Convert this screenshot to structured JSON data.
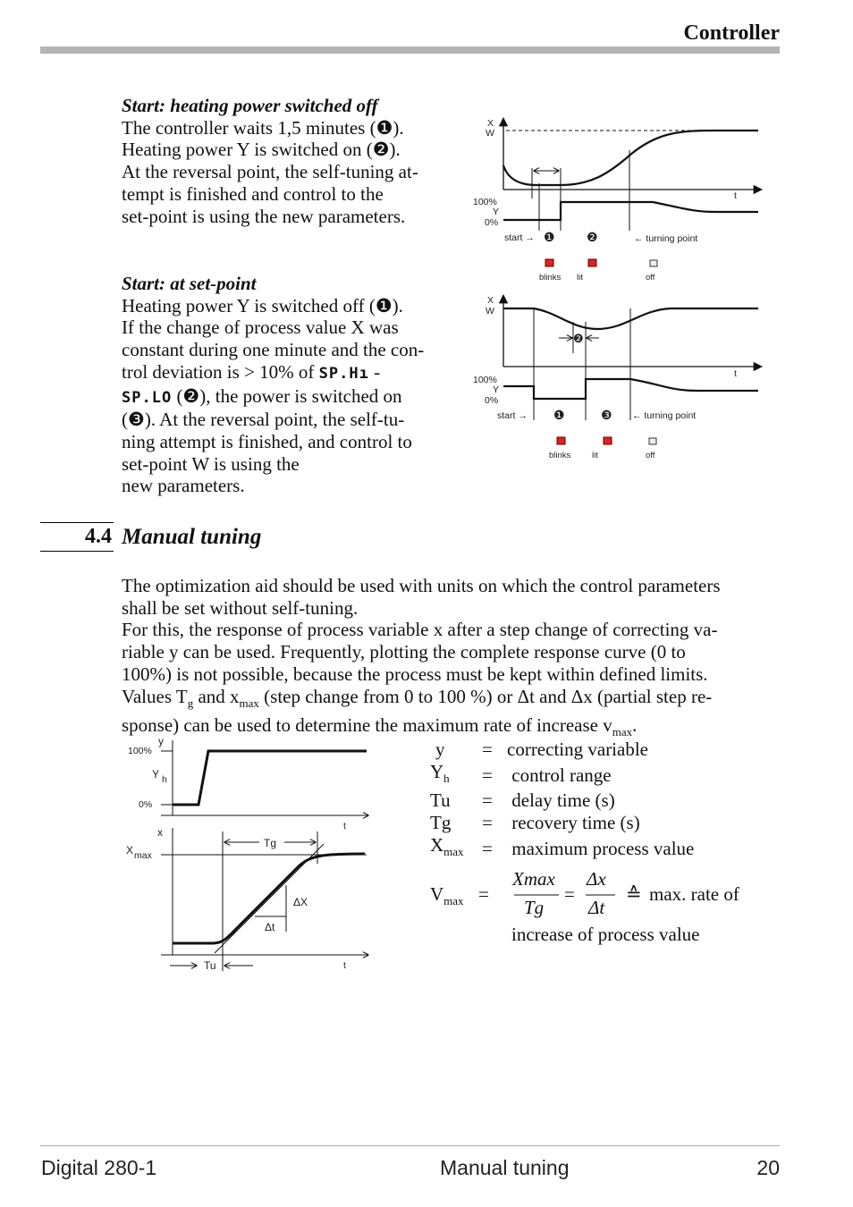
{
  "header": {
    "title": "Controller"
  },
  "block1": {
    "heading": "Start: heating power switched off",
    "lines": [
      "The controller waits 1,5 minutes (❶).",
      "Heating power Y is switched on (❷).",
      "At the reversal point, the self-tuning at-",
      "tempt is finished and control to the",
      "set-point is using the new parameters."
    ]
  },
  "block2": {
    "heading": "Start: at set-point",
    "l1": "Heating power Y is switched off (❶).",
    "l2": "If the change of process value X was",
    "l3": "constant during one minute and the con-",
    "l4a": "trol deviation is > 10% of ",
    "seg1": "SP.Hı",
    "l4b": " -",
    "seg2": "SP.LO",
    "l5b": " (❷), the power is switched on",
    "l6": "(❸). At the reversal point, the self-tu-",
    "l7": "ning attempt is finished, and control to",
    "l8": "set-point W is using the",
    "l9": "new parameters."
  },
  "diagram1": {
    "x": "X",
    "w": "W",
    "t": "t",
    "y100": "100%",
    "y": "Y",
    "y0": "0%",
    "start": "start →",
    "m1": "❶",
    "m2": "❷",
    "turn": "← turning point",
    "blinks": "blinks",
    "lit": "lit",
    "off": "off"
  },
  "diagram2": {
    "x": "X",
    "w": "W",
    "t": "t",
    "y100": "100%",
    "y": "Y",
    "y0": "0%",
    "start": "start →",
    "m1": "❶",
    "m2": "❷",
    "m3": "❸",
    "turn": "← turning point",
    "blinks": "blinks",
    "lit": "lit",
    "off": "off"
  },
  "section": {
    "number": "4.4",
    "title": "Manual tuning"
  },
  "body": {
    "lines": [
      "The optimization aid should be used with units on which the control parameters",
      "shall be set without self-tuning.",
      "For this, the response of process variable x after a step change of correcting va-",
      "riable y can be used. Frequently, plotting the complete response curve (0 to",
      "100%) is not possible, because the process must  be kept within defined limits."
    ],
    "l6a": "Values T",
    "l6g": "g",
    "l6b": " and x",
    "l6max": "max",
    "l6c": " (step change from 0 to 100 %) or Δt and Δx (partial step re-",
    "l7a": "sponse) can be used to determine the maximum rate of increase v",
    "l7max": "max",
    "l7b": "."
  },
  "figure": {
    "y100": "100%",
    "y": "y",
    "yh": "Y",
    "h": "h",
    "y0": "0%",
    "t": "t",
    "x": "x",
    "xmax": "X",
    "max": "max",
    "tg": "Tg",
    "dx": "ΔX",
    "dt": "Δt",
    "tu": "Tu"
  },
  "legend": [
    {
      "sym": "y",
      "sub": "",
      "eq": "=",
      "desc": "correcting variable"
    },
    {
      "sym": "Y",
      "sub": "h",
      "eq": "=",
      "desc": " control range"
    },
    {
      "sym": "Tu",
      "sub": "",
      "eq": "=",
      "desc": " delay time (s)"
    },
    {
      "sym": "Tg",
      "sub": "",
      "eq": "=",
      "desc": " recovery time (s)"
    },
    {
      "sym": "X",
      "sub": "max",
      "eq": "=",
      "desc": " maximum process value"
    }
  ],
  "formula": {
    "v": "V",
    "max": "max",
    "eq": "=",
    "num1": "Xmax",
    "den1": "Tg",
    "eq2": "=",
    "num2": "Δx",
    "den2": "Δt",
    "corr": "≙",
    "tail": "max. rate of",
    "line2": "increase of process value"
  },
  "footer": {
    "left": "Digital 280-1",
    "center": "Manual tuning",
    "right": "20"
  }
}
